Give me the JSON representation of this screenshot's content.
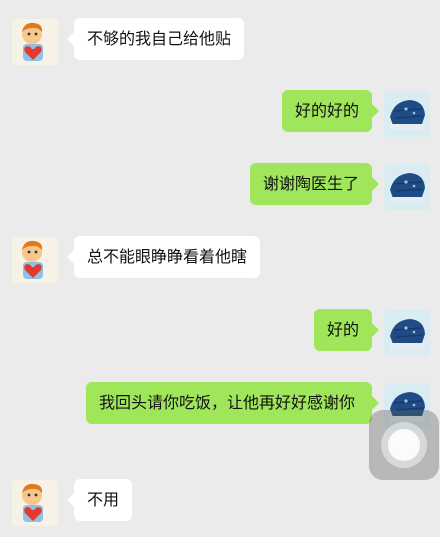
{
  "messages": [
    {
      "sender": "other",
      "text": "不够的我自己给他贴"
    },
    {
      "sender": "me",
      "text": "好的好的"
    },
    {
      "sender": "me",
      "text": "谢谢陶医生了"
    },
    {
      "sender": "other",
      "text": "总不能眼睁睁看着他瞎"
    },
    {
      "sender": "me",
      "text": "好的"
    },
    {
      "sender": "me",
      "text": "我回头请你吃饭，让他再好好感谢你"
    },
    {
      "sender": "other",
      "text": "不用"
    }
  ],
  "avatars": {
    "other": "cartoon-boy-holding-heart-icon",
    "me": "blue-cap-photo-icon"
  },
  "colors": {
    "background": "#ebebeb",
    "outgoing_bubble": "#9fe65b",
    "incoming_bubble": "#ffffff"
  },
  "floating_button": "assistive-touch-icon"
}
